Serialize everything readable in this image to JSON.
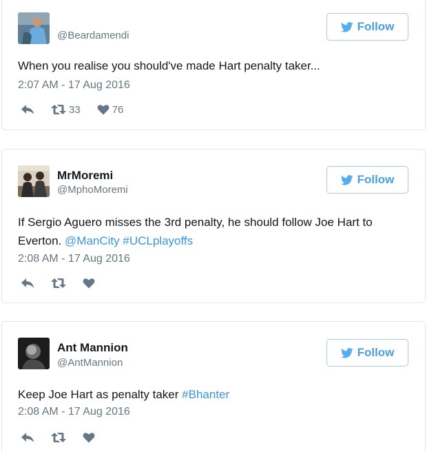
{
  "colors": {
    "link": "#3b94d9",
    "follow_text": "#4b9fd5",
    "muted": "#66757f",
    "icon": "#657786"
  },
  "icons": {
    "follow": "twitter-bird-icon",
    "reply": "reply-icon",
    "retweet": "retweet-icon",
    "like": "heart-icon"
  },
  "tweets": [
    {
      "name": "",
      "handle": "@Beardamendi",
      "follow_label": "Follow",
      "text": "When you realise you should've made Hart penalty taker...",
      "timestamp": "2:07 AM - 17 Aug 2016",
      "retweets": "33",
      "likes": "76"
    },
    {
      "name": "MrMoremi",
      "handle": "@MphoMoremi",
      "follow_label": "Follow",
      "text": "If Sergio Aguero misses the 3rd penalty, he should follow Joe Hart to Everton.",
      "links": [
        "@ManCity",
        "#UCLplayoffs"
      ],
      "timestamp": "2:08 AM - 17 Aug 2016"
    },
    {
      "name": "Ant Mannion",
      "handle": "@AntMannion",
      "follow_label": "Follow",
      "text": "Keep Joe Hart as penalty taker",
      "links": [
        "#Bhanter"
      ],
      "timestamp": "2:08 AM - 17 Aug 2016"
    }
  ]
}
